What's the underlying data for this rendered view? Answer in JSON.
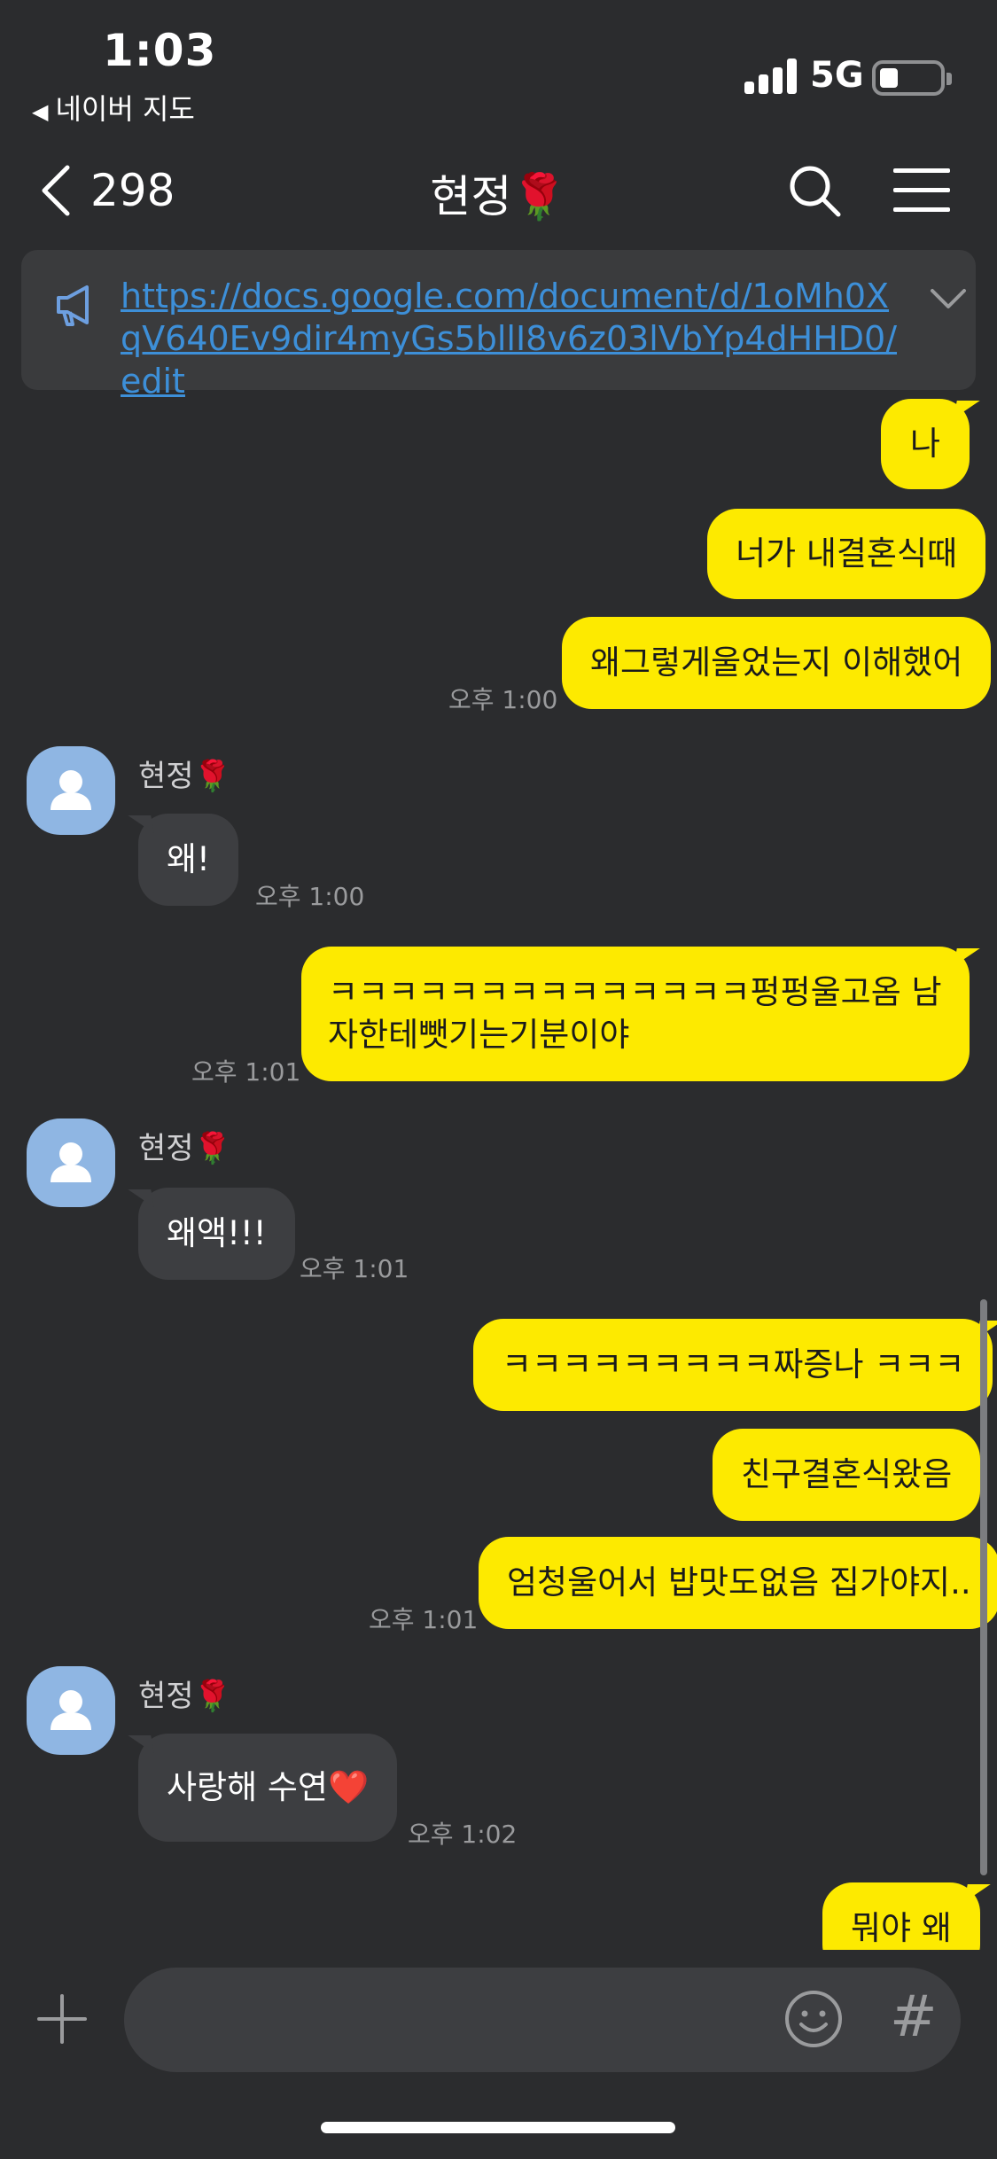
{
  "status_bar": {
    "time": "1:03",
    "back_app": "네이버 지도",
    "network": "5G"
  },
  "header": {
    "back_count": "298",
    "title": "현정🌹"
  },
  "notice": {
    "link": "https://docs.google.com/document/d/1oMh0XqV640Ev9dir4myGs5bllI8v6z03lVbYp4dHHD0/edit"
  },
  "messages": {
    "m1": "나",
    "m2": "너가 내결혼식때",
    "m3": "왜그렇게울었는지 이해했어",
    "t3": "오후 1:00",
    "sender1": "현정🌹",
    "m4": "왜!",
    "t4": "오후 1:00",
    "m5": "ㅋㅋㅋㅋㅋㅋㅋㅋㅋㅋㅋㅋㅋㅋ펑펑울고옴 남자한테뺏기는기분이야",
    "t5": "오후 1:01",
    "sender2": "현정🌹",
    "m6": "왜액!!!",
    "t6": "오후 1:01",
    "m7": "ㅋㅋㅋㅋㅋㅋㅋㅋㅋ짜증나 ㅋㅋㅋ",
    "m8": "친구결혼식왔음",
    "m9": "엄청울어서 밥맛도없음 집가야지..",
    "t9": "오후 1:01",
    "sender3": "현정🌹",
    "m10": "사랑해 수연❤️",
    "t10": "오후 1:02",
    "m11": "뭐야 왜"
  },
  "input": {
    "placeholder": "",
    "hash_label": "#"
  },
  "colors": {
    "background": "#2b2c2e",
    "my_bubble": "#fdea00",
    "their_bubble": "#3d3e41",
    "link": "#3d8fd8",
    "avatar": "#8fb6e3"
  }
}
